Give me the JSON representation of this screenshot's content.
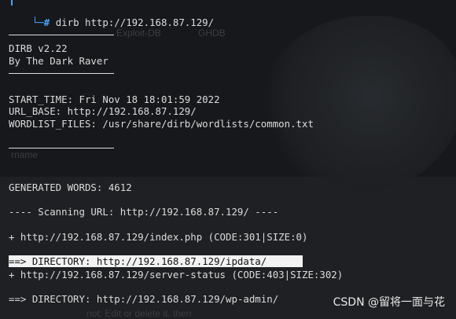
{
  "terminal": {
    "command_prompt": "# ",
    "command": "dirb http://192.168.87.129/",
    "banner_name": "DIRB v2.22",
    "banner_author": "By The Dark Raver",
    "start_time": "START_TIME: Fri Nov 18 18:01:59 2022",
    "url_base": "URL_BASE: http://192.168.87.129/",
    "wordlist_files": "WORDLIST_FILES: /usr/share/dirb/wordlists/common.txt",
    "generated_words": "GENERATED WORDS: 4612",
    "scanning": "---- Scanning URL: http://192.168.87.129/ ----",
    "results": [
      "+ http://192.168.87.129/index.php (CODE:301|SIZE:0)",
      "==> DIRECTORY: http://192.168.87.129/ipdata/",
      "+ http://192.168.87.129/server-status (CODE:403|SIZE:302)",
      "==> DIRECTORY: http://192.168.87.129/wp-admin/"
    ]
  },
  "background_ghost_text": [
    "Exploit-DB",
    "GHDB",
    "rname",
    "not: Edit or delete it, then"
  ],
  "watermark": "CSDN @留将一面与花",
  "colors": {
    "background": "#16181b",
    "text": "#dcdcdc",
    "prompt_accent": "#4aa3ff",
    "highlight": "#f2f2f2"
  }
}
